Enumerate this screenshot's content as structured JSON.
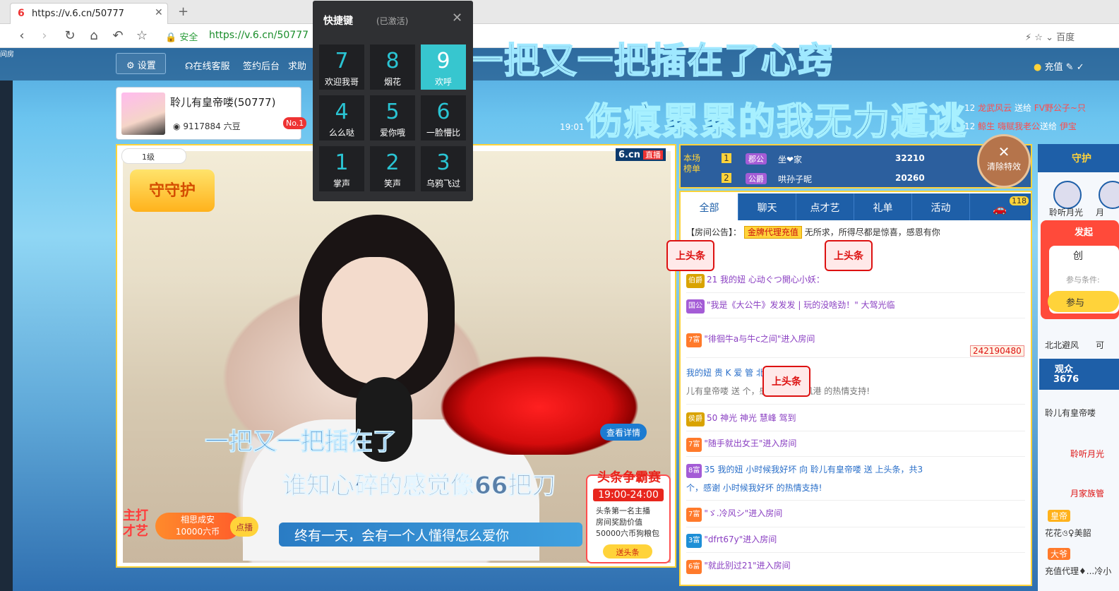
{
  "browser": {
    "tab_title": "https://v.6.cn/50777",
    "secure_label": "安全",
    "url": "https://v.6.cn/50777",
    "search_engine": "百度"
  },
  "site": {
    "logo_text": "间房",
    "settings": "设置",
    "links": [
      "在线客服",
      "签约后台",
      "求助"
    ],
    "recharge": "充值"
  },
  "banners": {
    "top": "一把又一把插在了心窍",
    "second": "伤痕累累的我无力遁逃"
  },
  "anchor": {
    "name": "聆儿有皇帝喽(50777)",
    "beans": "9117884 六豆",
    "rank_badge": "No.1",
    "time": "19:01"
  },
  "gift_feed": [
    {
      "time": "12",
      "from": "龙武风云",
      "verb": "送给",
      "to": "FV野公子~只"
    },
    {
      "time": "12",
      "from": "鲸生",
      "verb": "嗨赋我老公",
      "verb2": "送给",
      "to": "伊宝"
    }
  ],
  "hotkeys": {
    "title": "快捷键",
    "status": "(已激活)",
    "items": [
      {
        "key": "7",
        "label": "欢迎我哥"
      },
      {
        "key": "8",
        "label": "烟花"
      },
      {
        "key": "9",
        "label": "欢呼"
      },
      {
        "key": "4",
        "label": "么么哒"
      },
      {
        "key": "5",
        "label": "爱你哦"
      },
      {
        "key": "6",
        "label": "一脸懵比"
      },
      {
        "key": "1",
        "label": "掌声"
      },
      {
        "key": "2",
        "label": "笑声"
      },
      {
        "key": "3",
        "label": "乌鸦飞过"
      }
    ]
  },
  "video": {
    "level": "1级",
    "guard_label": "守守护",
    "site_badge": "6.cn",
    "live_badge": "直播",
    "detail_btn": "查看详情",
    "lyric1": "一把又一把插在了",
    "lyric2": "谁知心碎的感觉像66把刀",
    "lyric3": "终有一天，会有一个人懂得怎么爱你",
    "talent": {
      "title": "主打\n才艺",
      "song": "相思成安",
      "price": "10000六币",
      "btn": "点播"
    },
    "contest": {
      "title": "头条争霸赛",
      "time": "19:00-24:00",
      "desc": "头条第一名主播\n房间奖励价值\n50000六币狗粮包",
      "btn": "送头条"
    }
  },
  "rank": {
    "label": "本场\n榜单",
    "rows": [
      {
        "n": "1",
        "title": "郡公",
        "name": "坐❤家",
        "value": "32210"
      },
      {
        "n": "2",
        "title": "公爵",
        "name": "哄孙子昵",
        "value": "20260"
      }
    ]
  },
  "effects": {
    "clear": "清除特效"
  },
  "chat": {
    "tabs": [
      "全部",
      "聊天",
      "点才艺",
      "礼单",
      "活动"
    ],
    "car_count": "118",
    "notice_prefix": "【房间公告】：",
    "notice_tag": "金牌代理充值",
    "notice_text": "无所求，所得尽都是惊喜，感恩有你",
    "headline": "上头条",
    "messages": [
      {
        "badge": "伯爵",
        "text": "21 我的妞  心动ぐつ開心小妖："
      },
      {
        "badge": "国公",
        "text": "\"我是《大公牛》发发发 | 玩的没啥劲！\" 大驾光临"
      },
      {
        "badge": "7富",
        "text": "\"徘徊牛a与牛c之间\"进入房间"
      },
      {
        "badge": "",
        "text": "我的妞  贵  K 爱 管 北北避风港 向"
      },
      {
        "badge": "",
        "text": "儿有皇帝喽 送    个，感谢 北北避风港 的热情支持!"
      },
      {
        "badge": "侯爵",
        "text": "50 神光  神光 慧峰 驾到"
      },
      {
        "badge": "7富",
        "text": "\"随手就出女王\"进入房间"
      },
      {
        "badge": "8富",
        "text": "35 我的妞   小时候我好坏 向 聆儿有皇帝喽 送 上头条，共3"
      },
      {
        "badge": "",
        "text": "个，感谢 小时候我好坏 的热情支持!"
      },
      {
        "badge": "7富",
        "text": "\"ゞ.冷风シ\"进入房间"
      },
      {
        "badge": "3富",
        "text": "\"dfrt67y\"进入房间"
      },
      {
        "badge": "6富",
        "text": "\"就此别过21\"进入房间"
      }
    ],
    "car_value": "242190480"
  },
  "right": {
    "guard_hd": "守护",
    "guards": [
      "聆听月光",
      "月"
    ],
    "launch": {
      "a": "发起",
      "c": "创",
      "d": "参与条件:",
      "e": "参与"
    },
    "names": [
      "北北避风",
      "可"
    ],
    "viewers_label": "观众",
    "viewers": "3676",
    "list": [
      "聆儿有皇帝喽",
      "聆听月光",
      "月家族管",
      "皇帝",
      "花花ও♀美韶",
      "大爷",
      "充值代理♦...冷小"
    ]
  }
}
